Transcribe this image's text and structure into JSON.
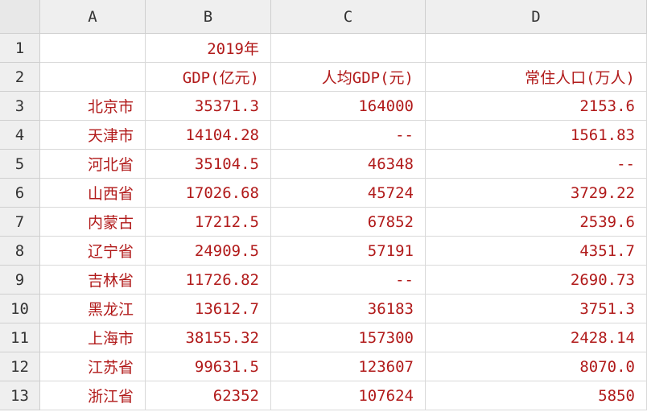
{
  "columns": [
    "A",
    "B",
    "C",
    "D"
  ],
  "colors": {
    "cell_text": "#b11a1a",
    "header_bg": "#efefef",
    "grid": "#d9d9d9"
  },
  "rows": [
    {
      "num": "1",
      "a": "",
      "b": "2019年",
      "c": "",
      "d": ""
    },
    {
      "num": "2",
      "a": "",
      "b": "GDP(亿元)",
      "c": "人均GDP(元)",
      "d": "常住人口(万人)"
    },
    {
      "num": "3",
      "a": "北京市",
      "b": "35371.3",
      "c": "164000",
      "d": "2153.6"
    },
    {
      "num": "4",
      "a": "天津市",
      "b": "14104.28",
      "c": "--",
      "d": "1561.83"
    },
    {
      "num": "5",
      "a": "河北省",
      "b": "35104.5",
      "c": "46348",
      "d": "--"
    },
    {
      "num": "6",
      "a": "山西省",
      "b": "17026.68",
      "c": "45724",
      "d": "3729.22"
    },
    {
      "num": "7",
      "a": "内蒙古",
      "b": "17212.5",
      "c": "67852",
      "d": "2539.6"
    },
    {
      "num": "8",
      "a": "辽宁省",
      "b": "24909.5",
      "c": "57191",
      "d": "4351.7"
    },
    {
      "num": "9",
      "a": "吉林省",
      "b": "11726.82",
      "c": "--",
      "d": "2690.73"
    },
    {
      "num": "10",
      "a": "黑龙江",
      "b": "13612.7",
      "c": "36183",
      "d": "3751.3"
    },
    {
      "num": "11",
      "a": "上海市",
      "b": "38155.32",
      "c": "157300",
      "d": "2428.14"
    },
    {
      "num": "12",
      "a": "江苏省",
      "b": "99631.5",
      "c": "123607",
      "d": "8070.0"
    },
    {
      "num": "13",
      "a": "浙江省",
      "b": "62352",
      "c": "107624",
      "d": "5850"
    }
  ]
}
